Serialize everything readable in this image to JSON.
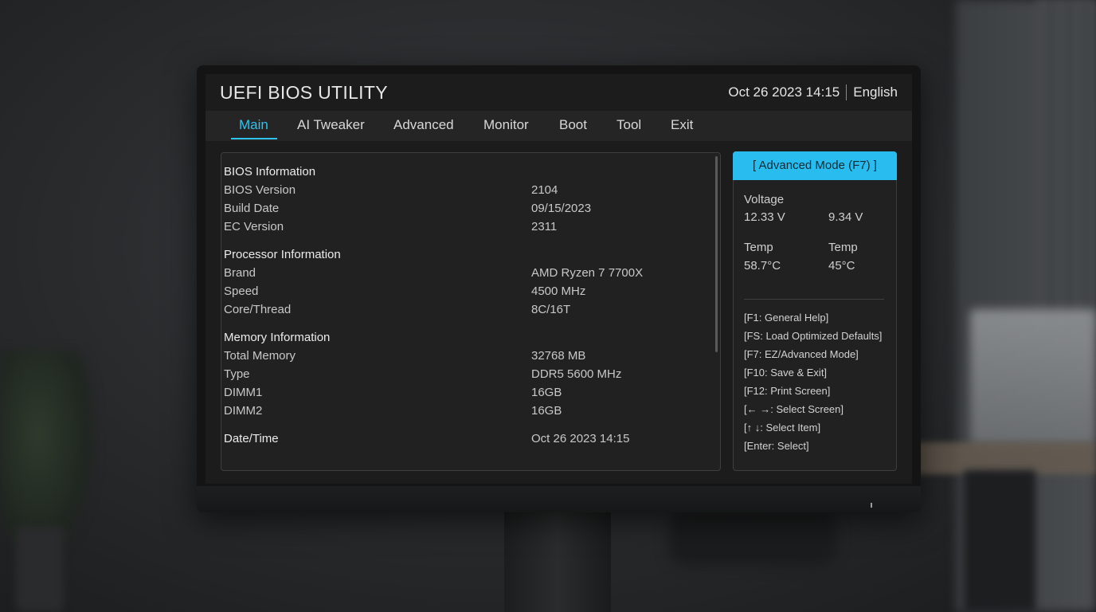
{
  "header": {
    "title": "UEFI BIOS UTILITY",
    "datetime": "Oct 26 2023 14:15",
    "language": "English"
  },
  "tabs": [
    {
      "label": "Main",
      "active": true
    },
    {
      "label": "AI Tweaker",
      "active": false
    },
    {
      "label": "Advanced",
      "active": false
    },
    {
      "label": "Monitor",
      "active": false
    },
    {
      "label": "Boot",
      "active": false
    },
    {
      "label": "Tool",
      "active": false
    },
    {
      "label": "Exit",
      "active": false
    }
  ],
  "main": {
    "bios_info": {
      "heading": "BIOS Information",
      "rows": [
        {
          "label": "BIOS Version",
          "value": "2104"
        },
        {
          "label": "Build Date",
          "value": "09/15/2023"
        },
        {
          "label": "EC Version",
          "value": "2311"
        }
      ]
    },
    "processor_info": {
      "heading": "Processor Information",
      "rows": [
        {
          "label": "Brand",
          "value": "AMD Ryzen 7 7700X"
        },
        {
          "label": "Speed",
          "value": "4500 MHz"
        },
        {
          "label": "Core/Thread",
          "value": "8C/16T"
        }
      ]
    },
    "memory_info": {
      "heading": "Memory Information",
      "rows": [
        {
          "label": "Total Memory",
          "value": "32768 MB"
        },
        {
          "label": "Type",
          "value": "DDR5 5600 MHz"
        },
        {
          "label": "DIMM1",
          "value": "16GB"
        },
        {
          "label": "DIMM2",
          "value": "16GB"
        }
      ]
    },
    "datetime": {
      "label": "Date/Time",
      "value": "Oct 26 2023 14:15"
    }
  },
  "side": {
    "mode_button": "[ Advanced Mode (F7) ]",
    "voltage_label": "Voltage",
    "voltage_values": [
      "12.33 V",
      "9.34 V"
    ],
    "temp_labels": [
      "Temp",
      "Temp"
    ],
    "temp_values": [
      "58.7°C",
      "45°C"
    ],
    "hotkeys": [
      "[F1: General Help]",
      "[FS: Load Optimized Defaults]",
      "[F7: EZ/Advanced Mode]",
      "[F10: Save & Exit]",
      "[F12: Print Screen]",
      "[← →: Select Screen]",
      "[↑ ↓: Select Item]",
      "[Enter: Select]"
    ]
  },
  "colors": {
    "accent": "#29bdef",
    "screen_bg": "#1c1c1c"
  }
}
